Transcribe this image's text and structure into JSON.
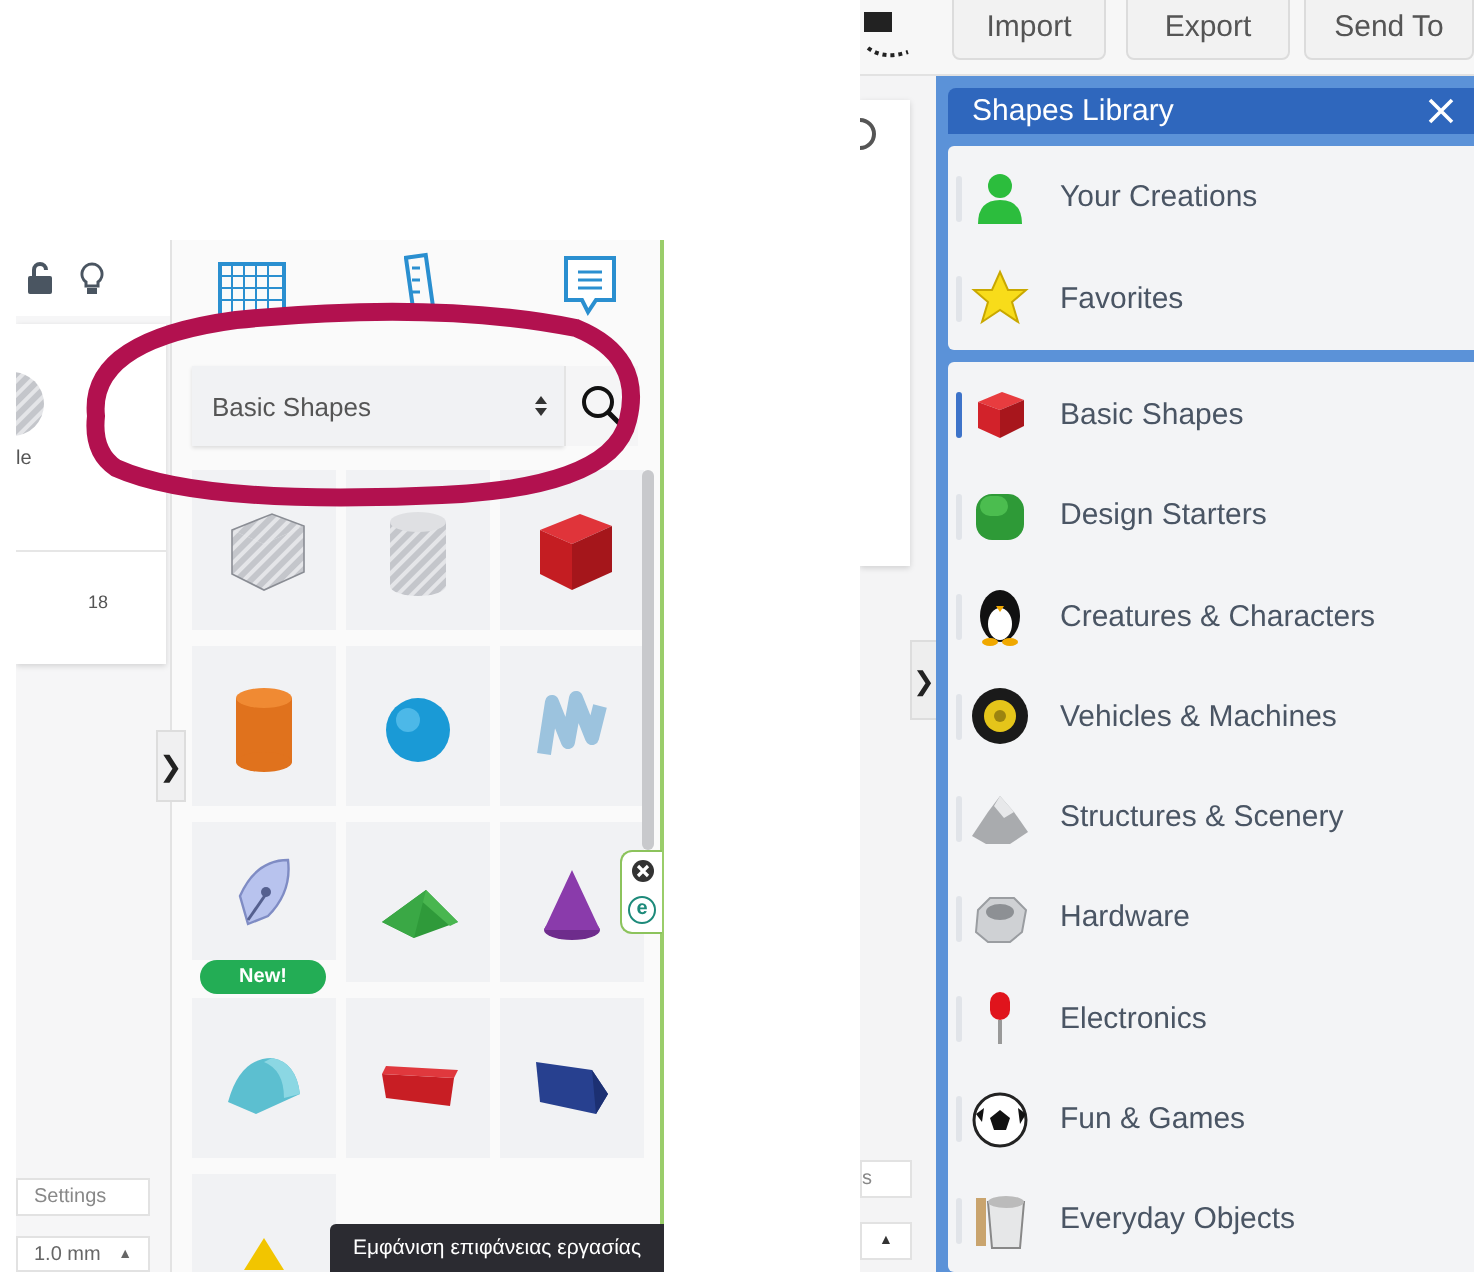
{
  "left_screenshot": {
    "properties_panel": {
      "partial_label": "le",
      "value": "18",
      "settings_field": "Settings",
      "grid_field": {
        "value": "1.0 mm",
        "arrow": "▲"
      }
    },
    "shape_picker": {
      "category_select": {
        "value": "Basic Shapes"
      },
      "shapes": [
        {
          "kind": "striped-box"
        },
        {
          "kind": "striped-cylinder"
        },
        {
          "kind": "box"
        },
        {
          "kind": "cylinder"
        },
        {
          "kind": "sphere"
        },
        {
          "kind": "scribble"
        },
        {
          "kind": "sketch",
          "badge": "New!"
        },
        {
          "kind": "roof"
        },
        {
          "kind": "cone"
        },
        {
          "kind": "round-roof"
        },
        {
          "kind": "text-shape"
        },
        {
          "kind": "wedge"
        },
        {
          "kind": "pyramid"
        }
      ]
    },
    "collapse_tab": "❯",
    "side_widget": {
      "letter": "e"
    },
    "tooltip": "Εμφάνιση επιφάνειας εργασίας"
  },
  "right_screenshot": {
    "toolbar_buttons": [
      "Import",
      "Export",
      "Send To"
    ],
    "collapse_tab": "❯",
    "partial_field": "s",
    "arrow_field": "▲",
    "shapes_library": {
      "title": "Shapes Library",
      "groups": [
        [
          {
            "label": "Your Creations",
            "kind": "person",
            "selected": false
          },
          {
            "label": "Favorites",
            "kind": "star",
            "selected": false
          }
        ],
        [
          {
            "label": "Basic Shapes",
            "kind": "cube",
            "selected": true
          },
          {
            "label": "Design Starters",
            "kind": "rounded-cube",
            "selected": false
          },
          {
            "label": "Creatures & Characters",
            "kind": "penguin",
            "selected": false
          },
          {
            "label": "Vehicles & Machines",
            "kind": "wheel",
            "selected": false
          },
          {
            "label": "Structures & Scenery",
            "kind": "mountain",
            "selected": false
          },
          {
            "label": "Hardware",
            "kind": "nut",
            "selected": false
          },
          {
            "label": "Electronics",
            "kind": "led",
            "selected": false
          },
          {
            "label": "Fun & Games",
            "kind": "ball",
            "selected": false
          },
          {
            "label": "Everyday Objects",
            "kind": "cup",
            "selected": false
          }
        ]
      ]
    }
  }
}
